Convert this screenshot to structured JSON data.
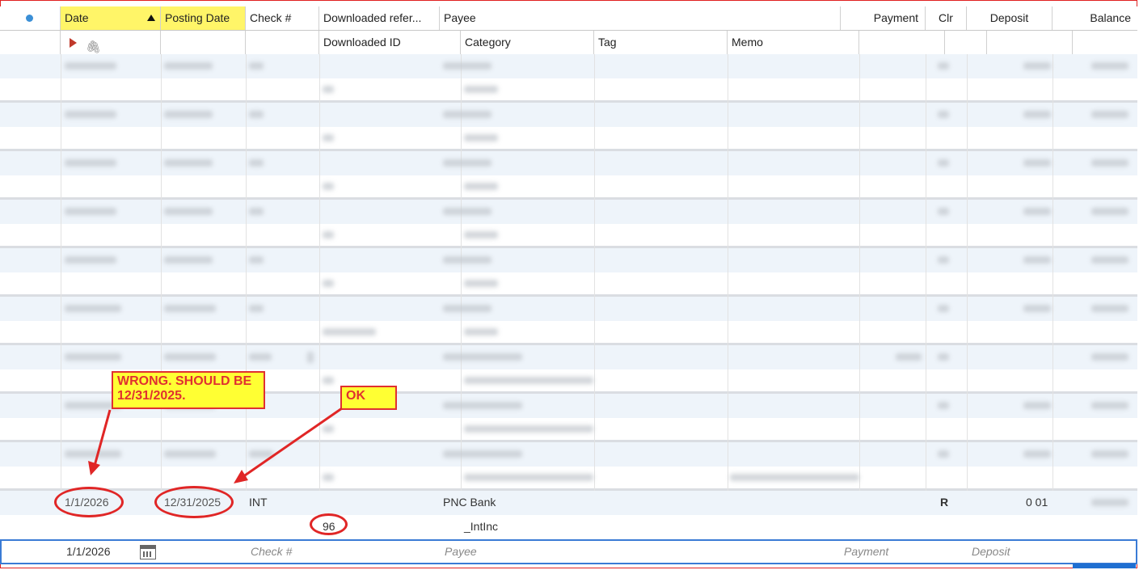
{
  "header_row1": {
    "date": "Date",
    "posting_date": "Posting Date",
    "check_num": "Check #",
    "downloaded_ref": "Downloaded refer...",
    "payee": "Payee",
    "payment": "Payment",
    "clr": "Clr",
    "deposit": "Deposit",
    "balance": "Balance"
  },
  "header_row2": {
    "downloaded_id": "Downloaded ID",
    "category": "Category",
    "tag": "Tag",
    "memo": "Memo"
  },
  "transaction": {
    "date": "1/1/2026",
    "posting_date": "12/31/2025",
    "check_num": "INT",
    "payee": "PNC Bank",
    "clr": "R",
    "deposit": "0 01",
    "downloaded_id": "96",
    "category": "_IntInc"
  },
  "entry_row": {
    "date": "1/1/2026",
    "check_placeholder": "Check #",
    "payee_placeholder": "Payee",
    "payment_placeholder": "Payment",
    "deposit_placeholder": "Deposit"
  },
  "annotations": {
    "wrong": "WRONG.  SHOULD BE 12/31/2025.",
    "ok": "OK"
  },
  "colors": {
    "highlight": "#fff568",
    "annotation_red": "#e02626",
    "callout_yellow": "#ffff33",
    "row_alt": "#eef4fa",
    "selection_blue": "#3a7bd5"
  }
}
